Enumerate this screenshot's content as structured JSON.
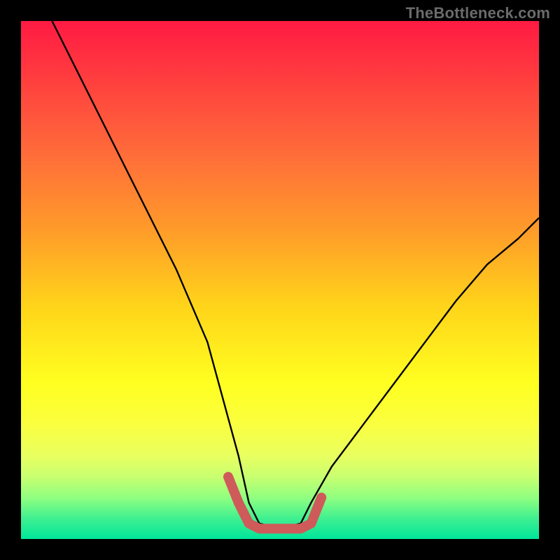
{
  "watermark": "TheBottleneck.com",
  "chart_data": {
    "type": "line",
    "title": "",
    "xlabel": "",
    "ylabel": "",
    "xlim": [
      0,
      100
    ],
    "ylim": [
      0,
      100
    ],
    "series": [
      {
        "name": "main-curve",
        "x": [
          6,
          12,
          18,
          24,
          30,
          36,
          39,
          42,
          44,
          46,
          50,
          54,
          56,
          60,
          66,
          72,
          78,
          84,
          90,
          96,
          100
        ],
        "y": [
          100,
          88,
          76,
          64,
          52,
          38,
          27,
          16,
          7,
          3,
          2,
          3,
          7,
          14,
          22,
          30,
          38,
          46,
          53,
          58,
          62
        ]
      },
      {
        "name": "bottom-notch",
        "x": [
          40,
          42,
          44,
          46,
          50,
          54,
          56,
          58
        ],
        "y": [
          12,
          7,
          3,
          2,
          2,
          2,
          3,
          8
        ]
      }
    ]
  },
  "colors": {
    "frame": "#000000",
    "curve": "#000000",
    "notch": "#cf5a5a"
  }
}
